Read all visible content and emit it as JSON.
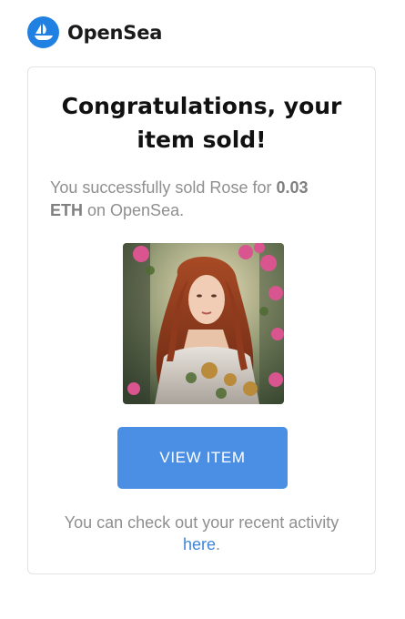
{
  "brand": {
    "name": "OpenSea",
    "logo_icon": "opensea-boat-icon",
    "logo_color": "#2081e2"
  },
  "card": {
    "title": "Congratulations, your item sold!",
    "message": {
      "prefix": "You successfully sold Rose for ",
      "amount": "0.03 ETH",
      "suffix": " on OpenSea."
    },
    "image": {
      "icon": "nft-artwork-image"
    },
    "button": {
      "label": "VIEW ITEM",
      "color": "#4a8fe3"
    },
    "footer": {
      "text": "You can check out your recent activity ",
      "link_label": "here",
      "suffix": ".",
      "link_color": "#3f86d6"
    }
  }
}
